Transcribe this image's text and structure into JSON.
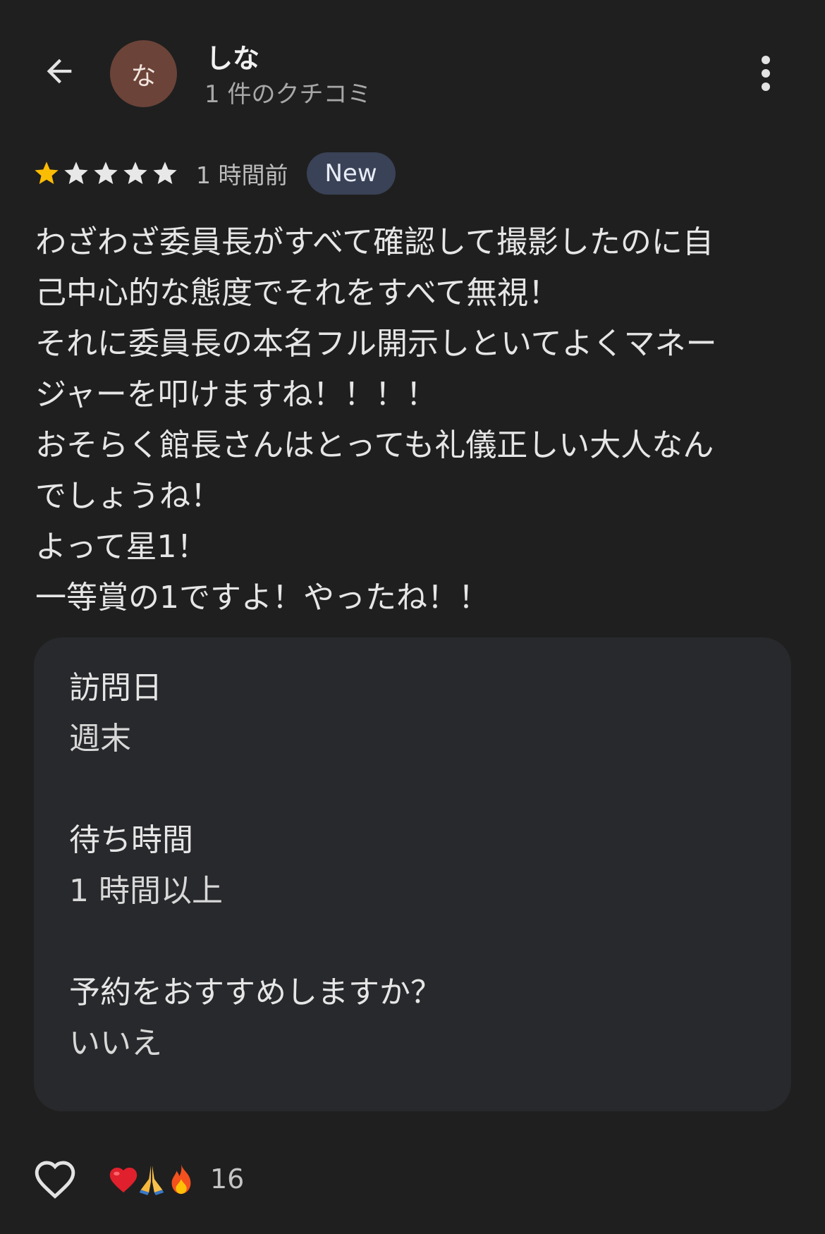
{
  "header": {
    "avatar_letter": "な",
    "avatar_color": "#6b4338",
    "user_name": "しな",
    "review_count": "1 件のクチコミ",
    "back_icon": "arrow-left-icon",
    "menu_icon": "more-vert-icon"
  },
  "review": {
    "rating": 1,
    "rating_max": 5,
    "star_filled_color": "#fbbc04",
    "star_empty_color": "#e8e8e8",
    "time_ago": "1 時間前",
    "badge": "New",
    "text": "わざわざ委員長がすべて確認して撮影したのに自\n己中心的な態度でそれをすべて無視！\nそれに委員長の本名フル開示しといてよくマネー\nジャーを叩けますね！！！！\nおそらく館長さんはとっても礼儀正しい大人なん\nでしょうね！\nよって星1！\n一等賞の1ですよ！やったね！！"
  },
  "details": [
    {
      "label": "訪問日",
      "value": "週末"
    },
    {
      "label": "待ち時間",
      "value": "1 時間以上"
    },
    {
      "label": "予約をおすすめしますか？",
      "value": "いいえ"
    }
  ],
  "footer": {
    "like_icon": "heart-outline-icon",
    "reactions": [
      "red-heart-emoji",
      "folded-hands-emoji",
      "fire-emoji"
    ],
    "reaction_count": "16"
  }
}
